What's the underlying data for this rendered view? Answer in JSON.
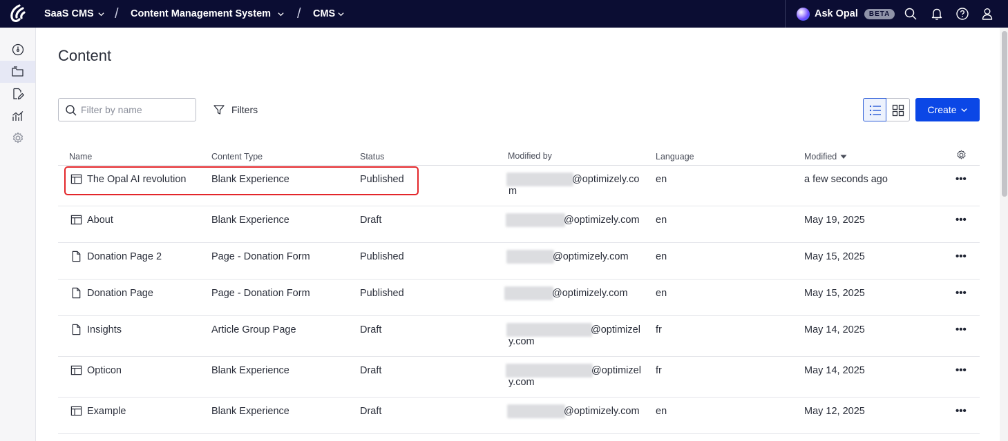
{
  "topbar": {
    "product": "SaaS CMS",
    "app": "Content Management System",
    "section": "CMS",
    "ask_opal": "Ask Opal",
    "beta": "BETA"
  },
  "page": {
    "title": "Content",
    "search_placeholder": "Filter by name",
    "filters_label": "Filters",
    "create_label": "Create"
  },
  "table": {
    "headers": {
      "name": "Name",
      "content_type": "Content Type",
      "status": "Status",
      "modified_by": "Modified by",
      "language": "Language",
      "modified": "Modified"
    },
    "rows": [
      {
        "name": "The Opal AI revolution",
        "icon": "layout-icon",
        "type": "Blank Experience",
        "status": "Published",
        "modified_by_line1": "@optimizely.co",
        "modified_by_line2": "m",
        "language": "en",
        "modified": "a few seconds ago"
      },
      {
        "name": "About",
        "icon": "layout-icon",
        "type": "Blank Experience",
        "status": "Draft",
        "modified_by_line1": "@optimizely.com",
        "modified_by_line2": "",
        "language": "en",
        "modified": "May 19, 2025"
      },
      {
        "name": "Donation Page 2",
        "icon": "page-icon",
        "type": "Page - Donation Form",
        "status": "Published",
        "modified_by_line1": "@optimizely.com",
        "modified_by_line2": "",
        "language": "en",
        "modified": "May 15, 2025"
      },
      {
        "name": "Donation Page",
        "icon": "page-icon",
        "type": "Page - Donation Form",
        "status": "Published",
        "modified_by_line1": "@optimizely.com",
        "modified_by_line2": "",
        "language": "en",
        "modified": "May 15, 2025"
      },
      {
        "name": "Insights",
        "icon": "page-icon",
        "type": "Article Group Page",
        "status": "Draft",
        "modified_by_line1": "@optimizel",
        "modified_by_line2": "y.com",
        "language": "fr",
        "modified": "May 14, 2025"
      },
      {
        "name": "Opticon",
        "icon": "layout-icon",
        "type": "Blank Experience",
        "status": "Draft",
        "modified_by_line1": "@optimizel",
        "modified_by_line2": "y.com",
        "language": "fr",
        "modified": "May 14, 2025"
      },
      {
        "name": "Example",
        "icon": "layout-icon",
        "type": "Blank Experience",
        "status": "Draft",
        "modified_by_line1": "@optimizely.com",
        "modified_by_line2": "",
        "language": "en",
        "modified": "May 12, 2025"
      }
    ],
    "actions_label": "•••"
  },
  "colors": {
    "topbar": "#0b0d33",
    "primary": "#0b47e6",
    "highlight": "#e3262a"
  }
}
